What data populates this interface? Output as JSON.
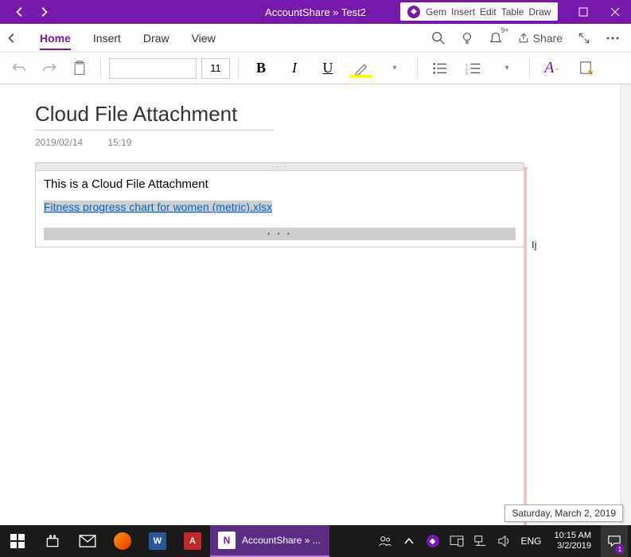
{
  "titlebar": {
    "title": "AccountShare » Test2",
    "addin": {
      "gem": "Gem",
      "insert": "Insert",
      "edit": "Edit",
      "table": "Table",
      "draw": "Draw"
    }
  },
  "menubar": {
    "home": "Home",
    "insert": "Insert",
    "draw": "Draw",
    "view": "View",
    "share": "Share",
    "bell_badge": "9+"
  },
  "toolbar": {
    "font_name": "",
    "font_size": "11"
  },
  "page": {
    "title": "Cloud File Attachment",
    "date": "2019/02/14",
    "time": "15:19",
    "paragraph": "This is a Cloud File Attachment",
    "attachment_link": "Fitness progress chart for women (metric).xlsx",
    "annotation": "Ij"
  },
  "tooltip": "Saturday, March 2, 2019",
  "taskbar": {
    "active_app": "AccountShare » ...",
    "lang": "ENG",
    "time": "10:15 AM",
    "date": "3/2/2019",
    "notif_count": "1"
  }
}
